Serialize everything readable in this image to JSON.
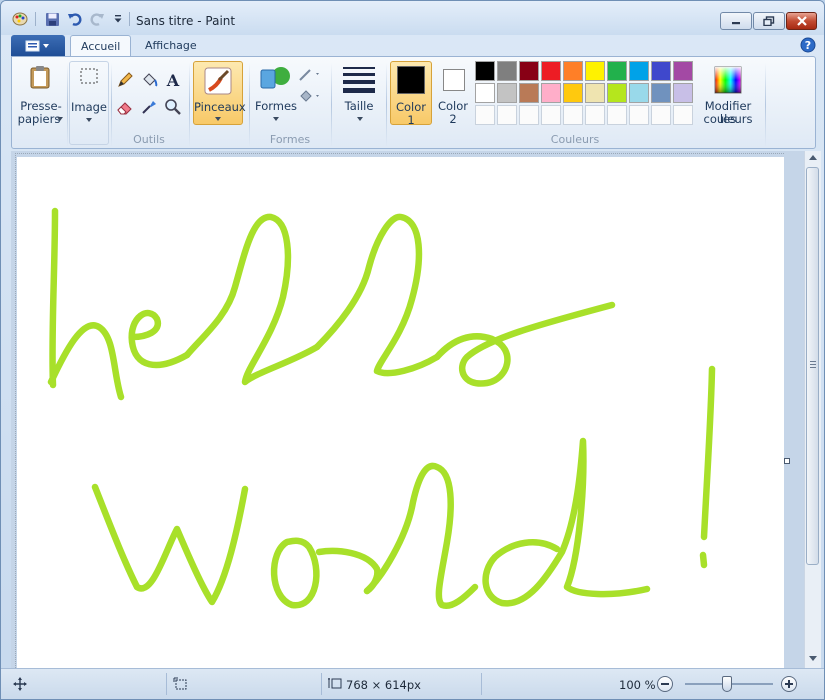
{
  "window": {
    "title": "Sans titre - Paint",
    "help_icon": "help-icon"
  },
  "tabs": {
    "file_menu_icon": "file-menu-icon",
    "home": "Accueil",
    "view": "Affichage"
  },
  "ribbon": {
    "clipboard": {
      "label_line1": "Presse-",
      "label_line2": "papiers"
    },
    "image": {
      "label": "Image"
    },
    "tools": {
      "group_label": "Outils"
    },
    "brushes": {
      "label": "Pinceaux"
    },
    "shapes": {
      "label": "Formes",
      "group_label": "Formes"
    },
    "size": {
      "label": "Taille"
    },
    "color1": {
      "label": "Color",
      "num": "1",
      "value": "#000000"
    },
    "color2": {
      "label": "Color",
      "num": "2",
      "value": "#ffffff"
    },
    "colors_group_label": "Couleurs",
    "edit_colors": {
      "label_line1": "Modifier les",
      "label_line2": "couleurs"
    },
    "palette_row1": [
      "#000000",
      "#7f7f7f",
      "#880015",
      "#ed1c24",
      "#ff7f27",
      "#fff200",
      "#22b14c",
      "#00a2e8",
      "#3f48cc",
      "#a349a4"
    ],
    "palette_row2": [
      "#ffffff",
      "#c3c3c3",
      "#b97a57",
      "#ffaec9",
      "#ffc90e",
      "#efe4b0",
      "#b5e61d",
      "#99d9ea",
      "#7092be",
      "#c8bfe7"
    ]
  },
  "canvas": {
    "stroke_color": "#a8e02a"
  },
  "status": {
    "canvas_size": "768 × 614px",
    "zoom": "100 %"
  }
}
